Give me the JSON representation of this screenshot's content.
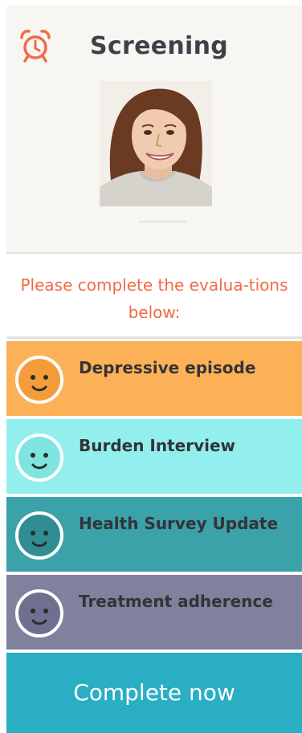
{
  "header": {
    "title": "Screening",
    "alarm_icon": "alarm-clock-icon",
    "accent_color": "#f26a47"
  },
  "prompt": {
    "text": "Please complete the evalua-tions below:"
  },
  "evaluations": [
    {
      "label": "Depressive episode",
      "color": "#fdb157",
      "face_color": "#f39c39",
      "icon": "smiley-face-icon"
    },
    {
      "label": "Burden Interview",
      "color": "#92efed",
      "face_color": "#7fe3e0",
      "icon": "smiley-face-icon"
    },
    {
      "label": "Health Survey Update",
      "color": "#3aa2a8",
      "face_color": "#2f8d93",
      "icon": "smiley-face-icon"
    },
    {
      "label": "Treatment adherence",
      "color": "#7f819d",
      "face_color": "#6e7090",
      "icon": "smiley-face-icon"
    }
  ],
  "cta": {
    "label": "Complete now",
    "color": "#2aaec4"
  }
}
